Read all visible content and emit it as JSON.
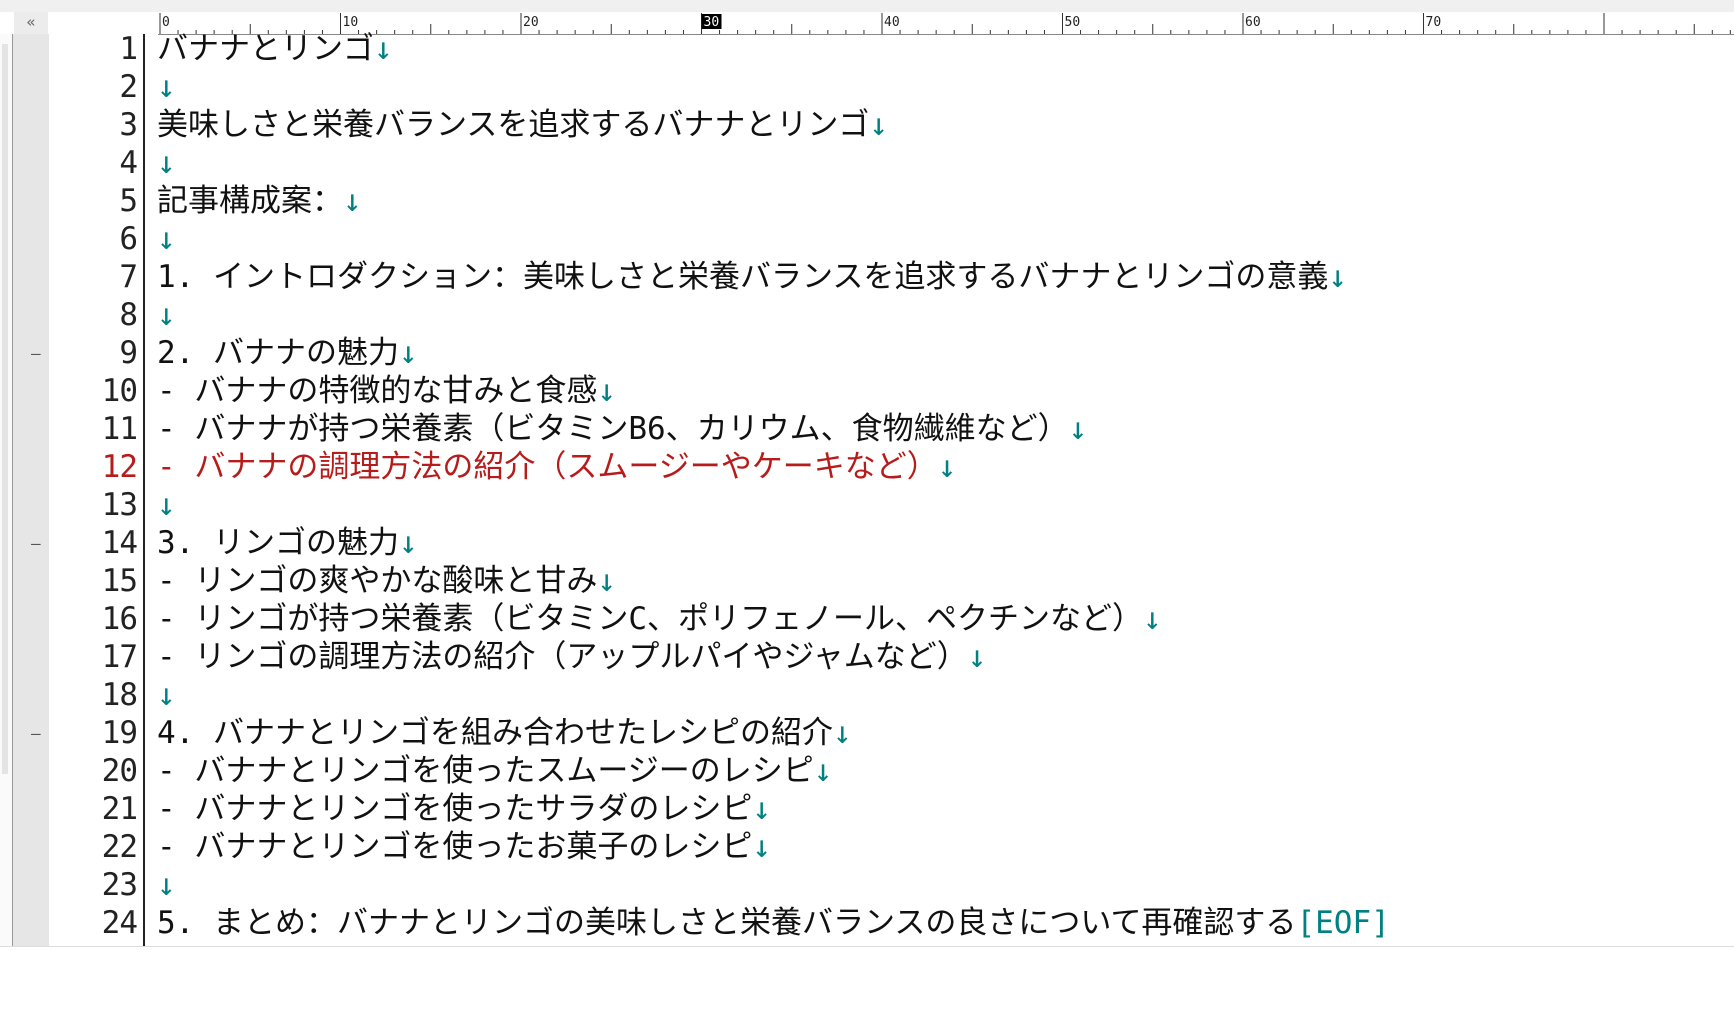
{
  "ruler": {
    "labels": [
      "0",
      "10",
      "20",
      "30",
      "40",
      "50",
      "60",
      "70"
    ],
    "current_column": "30"
  },
  "fold_toggle": "«",
  "eol_mark": "↓",
  "eof_mark": "[EOF]",
  "current_line": 12,
  "lines": [
    {
      "num": "1",
      "text": "バナナとリンゴ",
      "eol": true
    },
    {
      "num": "2",
      "text": "",
      "eol": true
    },
    {
      "num": "3",
      "text": "美味しさと栄養バランスを追求するバナナとリンゴ",
      "eol": true
    },
    {
      "num": "4",
      "text": "",
      "eol": true
    },
    {
      "num": "5",
      "text": "記事構成案：",
      "eol": true
    },
    {
      "num": "6",
      "text": "",
      "eol": true
    },
    {
      "num": "7",
      "text": "1. イントロダクション：美味しさと栄養バランスを追求するバナナとリンゴの意義",
      "eol": true
    },
    {
      "num": "8",
      "text": "",
      "eol": true
    },
    {
      "num": "9",
      "text": "2. バナナの魅力",
      "eol": true,
      "fold": true
    },
    {
      "num": "10",
      "text": "- バナナの特徴的な甘みと食感",
      "eol": true
    },
    {
      "num": "11",
      "text": "- バナナが持つ栄養素（ビタミンB6、カリウム、食物繊維など）",
      "eol": true
    },
    {
      "num": "12",
      "text": "- バナナの調理方法の紹介（スムージーやケーキなど）",
      "eol": true
    },
    {
      "num": "13",
      "text": "",
      "eol": true
    },
    {
      "num": "14",
      "text": "3. リンゴの魅力",
      "eol": true,
      "fold": true
    },
    {
      "num": "15",
      "text": "- リンゴの爽やかな酸味と甘み",
      "eol": true
    },
    {
      "num": "16",
      "text": "- リンゴが持つ栄養素（ビタミンC、ポリフェノール、ペクチンなど）",
      "eol": true
    },
    {
      "num": "17",
      "text": "- リンゴの調理方法の紹介（アップルパイやジャムなど）",
      "eol": true
    },
    {
      "num": "18",
      "text": "",
      "eol": true
    },
    {
      "num": "19",
      "text": "4. バナナとリンゴを組み合わせたレシピの紹介",
      "eol": true,
      "fold": true
    },
    {
      "num": "20",
      "text": "- バナナとリンゴを使ったスムージーのレシピ",
      "eol": true
    },
    {
      "num": "21",
      "text": "- バナナとリンゴを使ったサラダのレシピ",
      "eol": true
    },
    {
      "num": "22",
      "text": "- バナナとリンゴを使ったお菓子のレシピ",
      "eol": true
    },
    {
      "num": "23",
      "text": "",
      "eol": true
    },
    {
      "num": "24",
      "text": "5. まとめ：バナナとリンゴの美味しさと栄養バランスの良さについて再確認する",
      "eol": false,
      "eof": true
    }
  ],
  "colors": {
    "text": "#111111",
    "current_line": "#b71c1c",
    "eol_mark": "#008080",
    "gutter": "#e6e6e6"
  }
}
